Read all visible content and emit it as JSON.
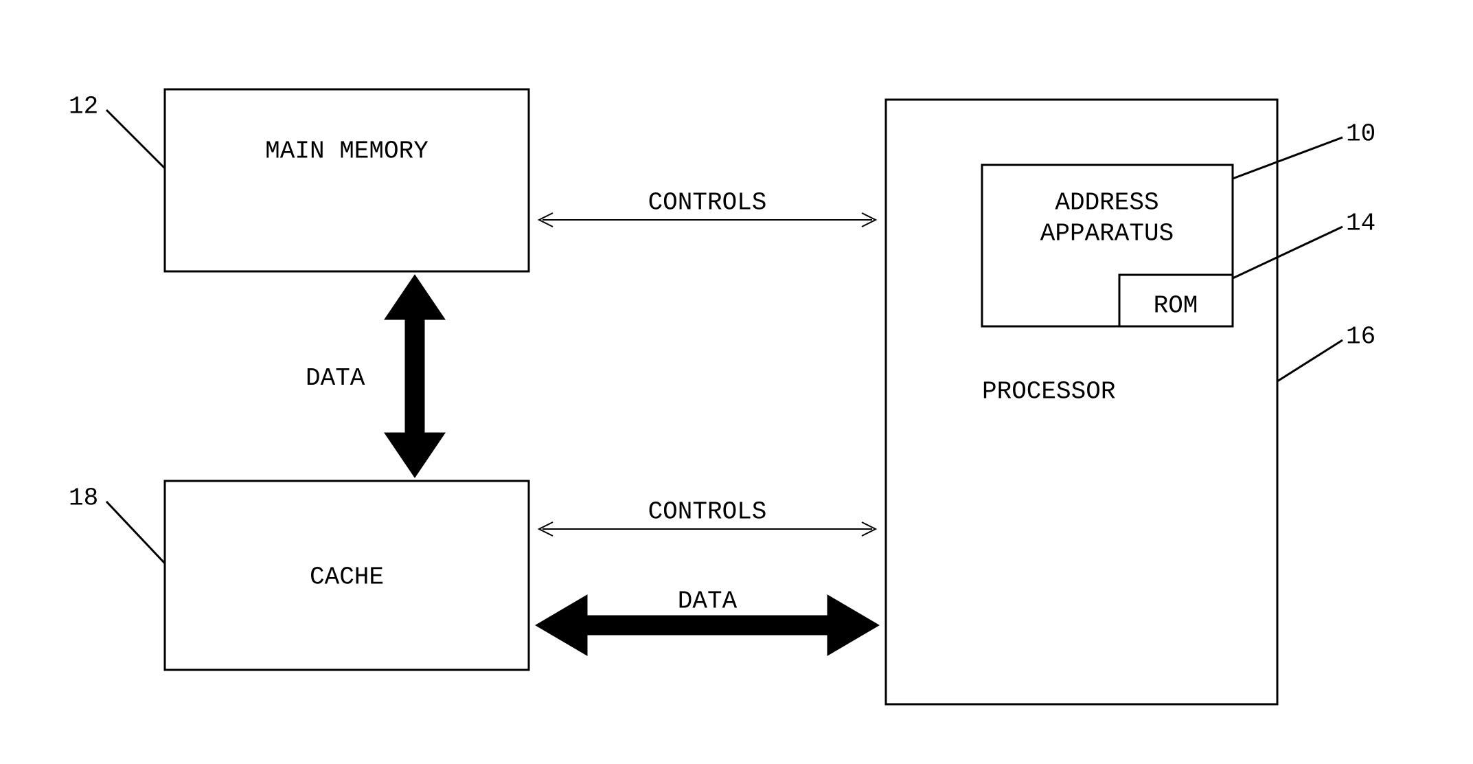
{
  "blocks": {
    "main_memory": {
      "label": "MAIN MEMORY",
      "ref": "12"
    },
    "cache": {
      "label": "CACHE",
      "ref": "18"
    },
    "processor": {
      "label": "PROCESSOR",
      "ref": "16"
    },
    "address_apparatus": {
      "label_line1": "ADDRESS",
      "label_line2": "APPARATUS",
      "ref": "10"
    },
    "rom": {
      "label": "ROM",
      "ref": "14"
    }
  },
  "connectors": {
    "mem_proc_controls": "CONTROLS",
    "mem_cache_data": "DATA",
    "cache_proc_controls": "CONTROLS",
    "cache_proc_data": "DATA"
  }
}
